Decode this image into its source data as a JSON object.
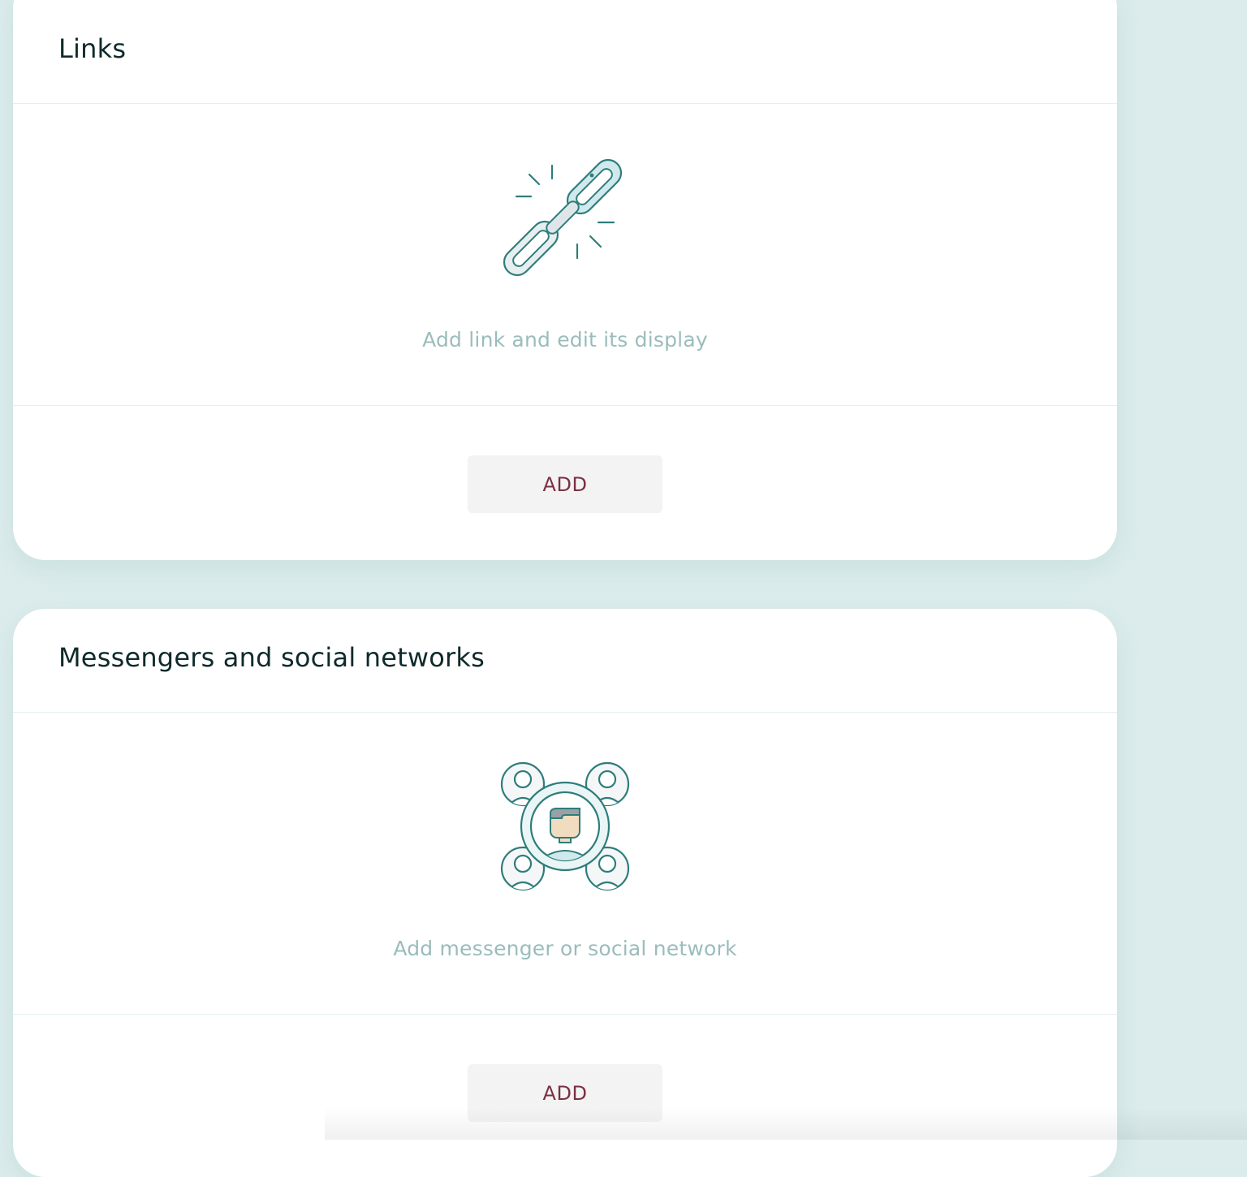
{
  "links_section": {
    "title": "Links",
    "icon": "broken-chain-icon",
    "hint": "Add link and edit its display",
    "add_label": "ADD"
  },
  "social_section": {
    "title": "Messengers and social networks",
    "icon": "social-network-people-icon",
    "hint": "Add messenger or social network",
    "add_label": "ADD"
  },
  "colors": {
    "page_background": "#dcecec",
    "card_background": "#ffffff",
    "title_text": "#0f2a2a",
    "hint_text": "#9bbcbc",
    "button_background": "#f3f3f3",
    "button_text": "#7a3042",
    "icon_stroke": "#2e7d7b",
    "icon_fill": "#cfe9ec"
  }
}
